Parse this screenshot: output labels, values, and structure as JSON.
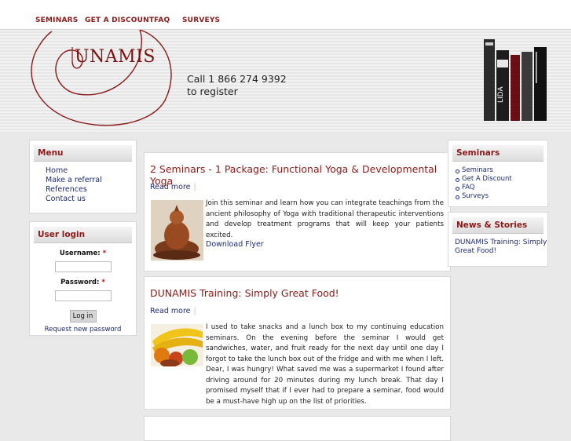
{
  "nav": {
    "items": [
      "SEMINARS",
      "GET A DISCOUNT",
      "FAQ",
      "SURVEYS"
    ]
  },
  "header": {
    "logo_text": "UNAMIS",
    "phone_line1": "Call 1 866 274 9392",
    "phone_line2": "to register",
    "book_spine_text": "LIDA"
  },
  "menu": {
    "title": "Menu",
    "items": [
      "Home",
      "Make a referral",
      "References",
      "Contact us"
    ]
  },
  "login": {
    "title": "User login",
    "username_label": "Username:",
    "password_label": "Password:",
    "required_mark": "*",
    "button": "Log in",
    "new_password": "Request new password"
  },
  "articles": [
    {
      "title": "2 Seminars - 1 Package: Functional Yoga & Developmental Yoga",
      "read_more": "Read more",
      "separator": "|",
      "text": "Join this seminar and learn how you can integrate teachings from the ancient philosophy of Yoga with traditional therapeutic interventions and develop treatment programs that will keep your patients excited.",
      "download": "Download Flyer"
    },
    {
      "title": "DUNAMIS Training: Simply Great Food!",
      "read_more": "Read more",
      "separator": "|",
      "text": "I used to take snacks and a lunch box to my continuing education seminars. On the evening before the seminar I would get sandwiches, water, and fruit ready for the next day until one day I forgot to take the lunch box out of the fridge and with me when I left. Dear, I was hungry! What saved me was a supermarket I found after driving around for 20 minutes during my lunch break. That day I promised myself that if I ever had to prepare a seminar, food would be a must-have high up on the list of priorities."
    }
  ],
  "right_sidebar": {
    "seminars_title": "Seminars",
    "seminar_links": [
      "Seminars",
      "Get A Discount",
      "FAQ",
      "Surveys"
    ],
    "news_title": "News & Stories",
    "news_item": "DUNAMIS Training: Simply Great Food!"
  },
  "colors": {
    "brand_red": "#8b1a1a",
    "link_blue": "#1e2b6b",
    "page_bg": "#e9e9e9"
  }
}
